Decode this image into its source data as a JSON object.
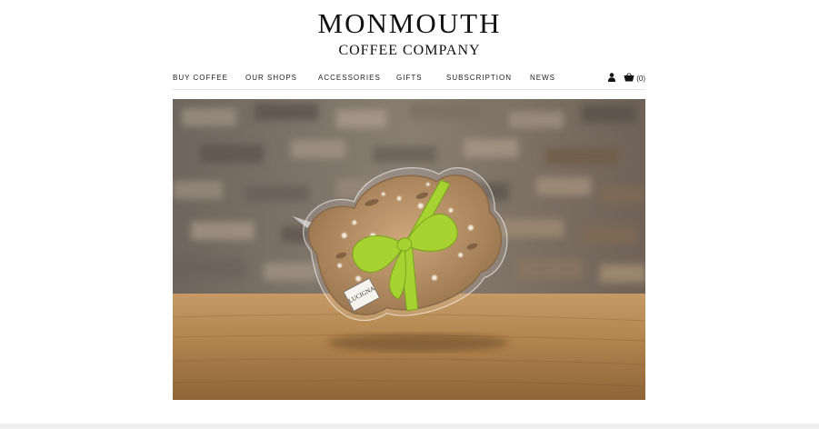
{
  "brand": {
    "name_line1": "MONMOUTH",
    "name_line2": "COFFEE COMPANY"
  },
  "nav": {
    "items": [
      {
        "label": "BUY COFFEE"
      },
      {
        "label": "OUR SHOPS"
      },
      {
        "label": "ACCESSORIES"
      },
      {
        "label": "GIFTS"
      },
      {
        "label": "SUBSCRIPTION"
      },
      {
        "label": "NEWS"
      }
    ],
    "account_icon": "user-icon",
    "cart_icon": "basket-icon",
    "cart_count": "(0)"
  },
  "hero": {
    "description_visible": false,
    "package_label": "LUCIGNA",
    "colors": {
      "wall": "#7d7166",
      "table": "#b68a5a",
      "ribbon": "#9ccc2c",
      "pastry": "#b88a5a"
    }
  }
}
